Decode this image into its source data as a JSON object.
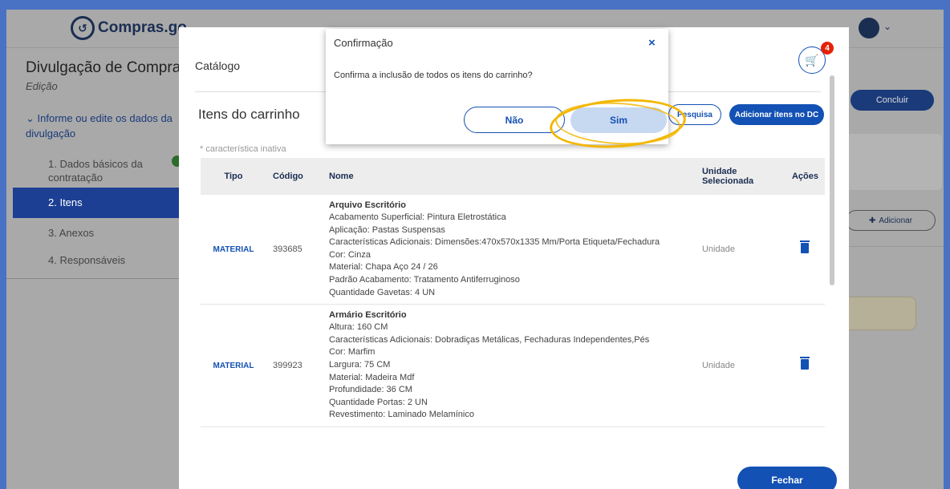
{
  "background": {
    "logo": "Compras.go",
    "title": "Divulgação de Compras",
    "subtitle": "Edição",
    "section": "Informe ou edite os dados da divulgação",
    "steps": [
      {
        "label": "1. Dados básicos da contratação"
      },
      {
        "label": "2. Itens"
      },
      {
        "label": "3. Anexos"
      },
      {
        "label": "4. Responsáveis"
      }
    ],
    "concluir": "Concluir",
    "adicionar": "Adicionar"
  },
  "catalog": {
    "title": "Catálogo",
    "cart_count": "4",
    "itens_title": "Itens do carrinho",
    "pesquisa_label": "Pesquisa",
    "adicionar_dc_label": "Adicionar itens no DC",
    "note": "* característica inativa",
    "headers": {
      "tipo": "Tipo",
      "codigo": "Código",
      "nome": "Nome",
      "unidade": "Unidade Selecionada",
      "acoes": "Ações"
    },
    "rows": [
      {
        "tipo": "MATERIAL",
        "codigo": "393685",
        "nome": "Arquivo Escritório",
        "unidade": "Unidade",
        "attrs": [
          "Acabamento Superficial: Pintura Eletrostática",
          "Aplicação: Pastas Suspensas",
          "Características Adicionais: Dimensões:470x570x1335 Mm/Porta Etiqueta/Fechadura",
          "Cor: Cinza",
          "Material: Chapa Aço 24 / 26",
          "Padrão Acabamento: Tratamento Antiferruginoso",
          "Quantidade Gavetas: 4 UN"
        ]
      },
      {
        "tipo": "MATERIAL",
        "codigo": "399923",
        "nome": "Armário Escritório",
        "unidade": "Unidade",
        "attrs": [
          "Altura: 160 CM",
          "Características Adicionais: Dobradiças Metálicas, Fechaduras Independentes,Pés",
          "Cor: Marfim",
          "Largura: 75 CM",
          "Material: Madeira Mdf",
          "Profundidade: 36 CM",
          "Quantidade Portas: 2 UN",
          "Revestimento: Laminado Melamínico"
        ]
      }
    ],
    "fechar_label": "Fechar"
  },
  "confirm": {
    "title": "Confirmação",
    "message": "Confirma a inclusão de todos os itens do carrinho?",
    "nao_label": "Não",
    "sim_label": "Sim",
    "close_symbol": "×"
  },
  "colors": {
    "primary": "#1351b4",
    "highlight": "#f2b600"
  }
}
